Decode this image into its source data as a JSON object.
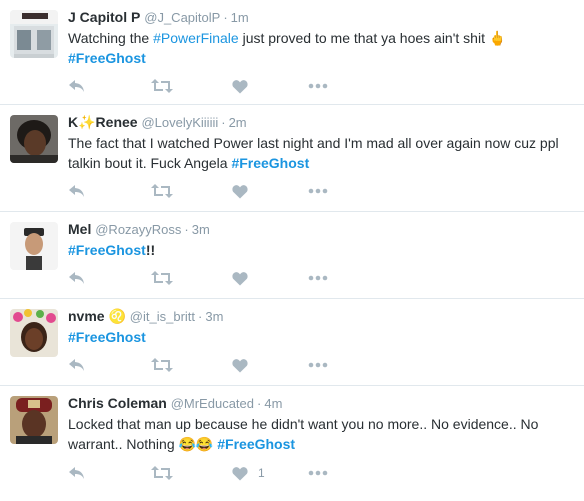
{
  "tweets": [
    {
      "name": "J Capitol P",
      "handle": "@J_CapitolP",
      "time": "1m",
      "text_lines": [
        [
          {
            "t": "Watching the ",
            "tag": false
          },
          {
            "t": "#PowerFinale",
            "tag": false,
            "link": true
          },
          {
            "t": " just proved to me that ya hoes ain't shit 🖕",
            "tag": false
          }
        ],
        [
          {
            "t": "#FreeGhost",
            "tag": true
          }
        ]
      ],
      "like_count": "",
      "avatar": "storefront-photo"
    },
    {
      "name": "K✨Renee",
      "handle": "@LovelyKiiiiii",
      "time": "2m",
      "text_lines": [
        [
          {
            "t": "The fact that I watched Power last night and I'm mad all over again now cuz ppl",
            "tag": false
          }
        ],
        [
          {
            "t": "talkin bout it. Fuck Angela ",
            "tag": false
          },
          {
            "t": "#FreeGhost",
            "tag": true
          }
        ]
      ],
      "like_count": "",
      "avatar": "person-photo"
    },
    {
      "name": "Mel",
      "handle": "@RozayyRoss",
      "time": "3m",
      "text_lines": [
        [
          {
            "t": "#FreeGhost",
            "tag": true
          },
          {
            "t": "!!",
            "tag": false
          }
        ]
      ],
      "like_count": "",
      "avatar": "person-photo"
    },
    {
      "name": "nvme ♌",
      "handle": "@it_is_britt",
      "time": "3m",
      "text_lines": [
        [
          {
            "t": "#FreeGhost",
            "tag": true
          }
        ]
      ],
      "like_count": "",
      "avatar": "person-photo"
    },
    {
      "name": "Chris Coleman",
      "handle": "@MrEducated",
      "time": "4m",
      "text_lines": [
        [
          {
            "t": "Locked that man up because he didn't want you no more.. No evidence.. No",
            "tag": false
          }
        ],
        [
          {
            "t": "warrant.. Nothing 😂😂 ",
            "tag": false
          },
          {
            "t": "#FreeGhost",
            "tag": true
          }
        ]
      ],
      "like_count": "1",
      "avatar": "person-photo"
    }
  ],
  "colors": {
    "hashtag": "#1b95e0",
    "icon": "#aab8c2",
    "meta": "#8899a6",
    "divider": "#e1e8ed"
  },
  "icons": [
    "reply-icon",
    "retweet-icon",
    "like-icon",
    "more-icon"
  ]
}
